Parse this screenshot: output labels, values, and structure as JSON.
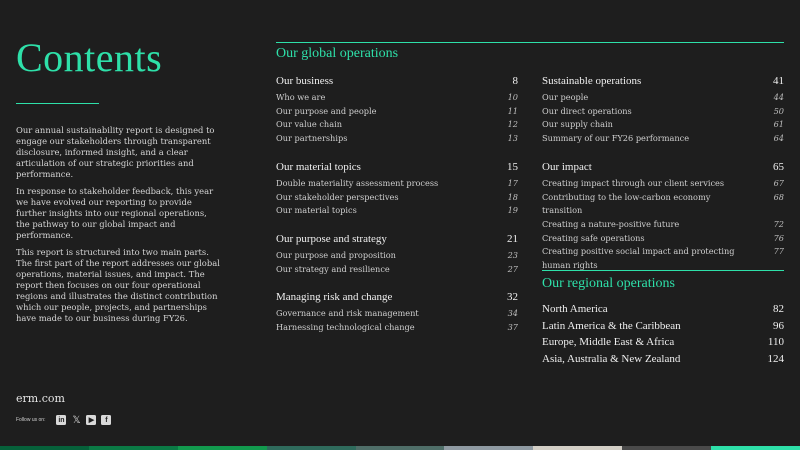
{
  "page": {
    "title": "Contents"
  },
  "intro": [
    "Our annual sustainability report is designed to engage our stakeholders through transparent disclosure, informed insight, and a clear articulation of our strategic priorities and performance.",
    "In response to stakeholder feedback, this year we have evolved our reporting to provide further insights into our regional operations, the pathway to our global impact and performance.",
    "This report is structured into two main parts. The first part of the report addresses our global operations, material issues, and impact. The report then focuses on our four operational regions and illustrates the distinct contribution which our people, projects, and partnerships have made to our business during FY26."
  ],
  "footer": {
    "site": "erm.com",
    "follow_label": "Follow us on:",
    "social_icons": [
      "linkedin-icon",
      "x-icon",
      "youtube-icon",
      "facebook-icon"
    ]
  },
  "colors": {
    "accent": "#2ee0a9",
    "bar": [
      "#06613a",
      "#0b7a45",
      "#129a4e",
      "#2f6b5c",
      "#4f6e68",
      "#8f9aa2",
      "#d3cfc6",
      "#4a4a4a",
      "#2ee0a9"
    ]
  },
  "global": {
    "heading": "Our global operations",
    "left_groups": [
      {
        "title": "Our business",
        "page": "8",
        "items": [
          {
            "label": "Who we are",
            "page": "10"
          },
          {
            "label": "Our purpose and people",
            "page": "11"
          },
          {
            "label": "Our value chain",
            "page": "12"
          },
          {
            "label": "Our partnerships",
            "page": "13"
          }
        ]
      },
      {
        "title": "Our material topics",
        "page": "15",
        "items": [
          {
            "label": "Double materiality assessment process",
            "page": "17"
          },
          {
            "label": "Our stakeholder perspectives",
            "page": "18"
          },
          {
            "label": "Our material topics",
            "page": "19"
          }
        ]
      },
      {
        "title": "Our purpose and strategy",
        "page": "21",
        "items": [
          {
            "label": "Our purpose and proposition",
            "page": "23"
          },
          {
            "label": "Our strategy and resilience",
            "page": "27"
          }
        ]
      },
      {
        "title": "Managing risk and change",
        "page": "32",
        "items": [
          {
            "label": "Governance and risk management",
            "page": "34"
          },
          {
            "label": "Harnessing technological change",
            "page": "37"
          }
        ]
      }
    ],
    "right_groups": [
      {
        "title": "Sustainable operations",
        "page": "41",
        "items": [
          {
            "label": "Our people",
            "page": "44"
          },
          {
            "label": "Our direct operations",
            "page": "50"
          },
          {
            "label": "Our supply chain",
            "page": "61"
          },
          {
            "label": "Summary of our FY26 performance",
            "page": "64"
          }
        ]
      },
      {
        "title": "Our impact",
        "page": "65",
        "items": [
          {
            "label": "Creating impact through our client services",
            "page": "67"
          },
          {
            "label": "Contributing to the low-carbon economy transition",
            "page": "68"
          },
          {
            "label": "Creating a nature-positive future",
            "page": "72"
          },
          {
            "label": "Creating safe operations",
            "page": "76"
          },
          {
            "label": "Creating positive social impact and protecting human rights",
            "page": "77"
          }
        ]
      }
    ]
  },
  "regional": {
    "heading": "Our regional operations",
    "items": [
      {
        "label": "North America",
        "page": "82"
      },
      {
        "label": "Latin America & the Caribbean",
        "page": "96"
      },
      {
        "label": "Europe, Middle East & Africa",
        "page": "110"
      },
      {
        "label": "Asia, Australia & New Zealand",
        "page": "124"
      }
    ]
  }
}
